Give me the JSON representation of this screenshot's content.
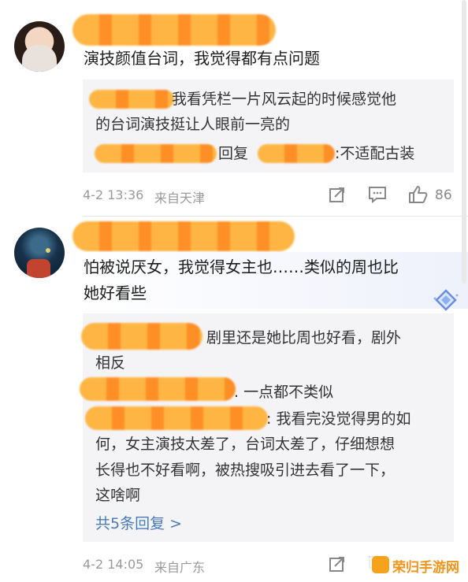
{
  "comment1": {
    "text": "演技颜值台词，我觉得都有点问题",
    "replies": [
      {
        "text_a": "我看凭栏一片风云起的时候感觉他",
        "text_b": "的台词演技挺让人眼前一亮的"
      },
      {
        "prefix": "回复",
        "suffix": ":不适配古装"
      }
    ],
    "time": "4-2 13:36",
    "source": "来自天津",
    "likes": "86"
  },
  "comment2": {
    "text_a": "怕被说厌女，我觉得女主也……类似的周也比",
    "text_b": "她好看些",
    "replies": [
      {
        "a": "剧里还是她比周也好看，剧外",
        "b": "相反"
      },
      {
        "a": ". 一点都不类似"
      },
      {
        "a": ": 我看完没觉得男的如",
        "b": "何，女主演技太差了，台词太差了，仔细想想",
        "c": "长得也不好看啊，被热搜吸引进去看了一下，",
        "d": "这啥啊"
      }
    ],
    "more": "共5条回复 >",
    "time": "4-2 14:05",
    "source": "来自广东"
  },
  "watermark": "荣归手游网",
  "colors": {
    "link": "#4a7bb8",
    "redact": "#ff9a2a",
    "reply_bg": "#f4f4f6"
  }
}
